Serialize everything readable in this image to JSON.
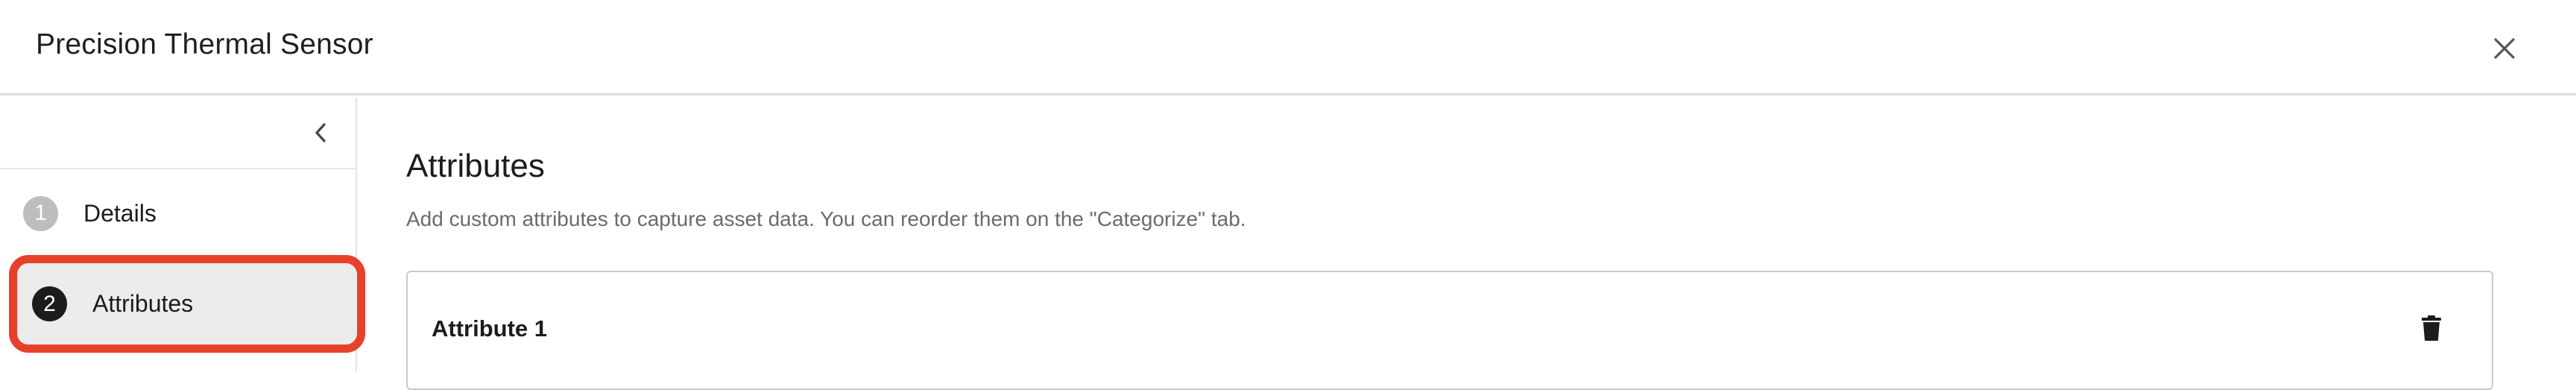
{
  "header": {
    "title": "Precision Thermal Sensor",
    "close_icon": "close-icon"
  },
  "sidebar": {
    "collapse_icon": "chevron-left-icon",
    "steps": [
      {
        "number": "1",
        "label": "Details",
        "active": false
      },
      {
        "number": "2",
        "label": "Attributes",
        "active": true
      }
    ]
  },
  "main": {
    "title": "Attributes",
    "description": "Add custom attributes to capture asset data. You can reorder them on the \"Categorize\" tab.",
    "attributes": [
      {
        "title": "Attribute 1",
        "delete_icon": "trash-icon"
      }
    ]
  },
  "colors": {
    "highlight_border": "#e8412a",
    "active_step_bg": "#ececec",
    "active_step_badge": "#1c1c1c",
    "inactive_step_badge": "#bdbdbd"
  }
}
